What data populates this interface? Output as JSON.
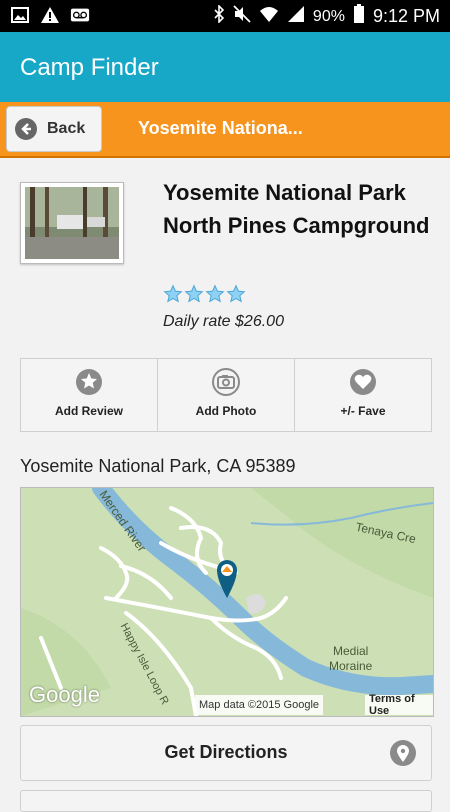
{
  "status_bar": {
    "battery_percent": "90%",
    "time": "9:12 PM",
    "left_icons": [
      "image-icon",
      "warning-icon",
      "voicemail-icon"
    ],
    "right_icons": [
      "bluetooth-icon",
      "mute-icon",
      "wifi-icon",
      "signal-icon",
      "battery-icon"
    ]
  },
  "app_bar": {
    "title": "Camp Finder",
    "color": "#17a8c7"
  },
  "sub_bar": {
    "back_label": "Back",
    "title": "Yosemite Nationa...",
    "color": "#f7941d"
  },
  "campground": {
    "name": "Yosemite National Park North Pines Campground",
    "rating_stars": 4,
    "daily_rate": "Daily rate $26.00"
  },
  "actions": [
    {
      "label": "Add Review",
      "icon": "star-circle-icon"
    },
    {
      "label": "Add Photo",
      "icon": "camera-icon"
    },
    {
      "label": "+/- Fave",
      "icon": "heart-icon"
    }
  ],
  "address": "Yosemite National Park, CA 95389",
  "map": {
    "labels": {
      "river": "Merced River",
      "creek": "Tenaya Cre",
      "moraine_line1": "Medial",
      "moraine_line2": "Moraine",
      "road": "Happy Isle Loop R"
    },
    "logo": "Google",
    "attribution": "Map data ©2015 Google",
    "terms": "Terms of Use"
  },
  "directions": {
    "label": "Get Directions",
    "icon": "location-pin-icon"
  }
}
